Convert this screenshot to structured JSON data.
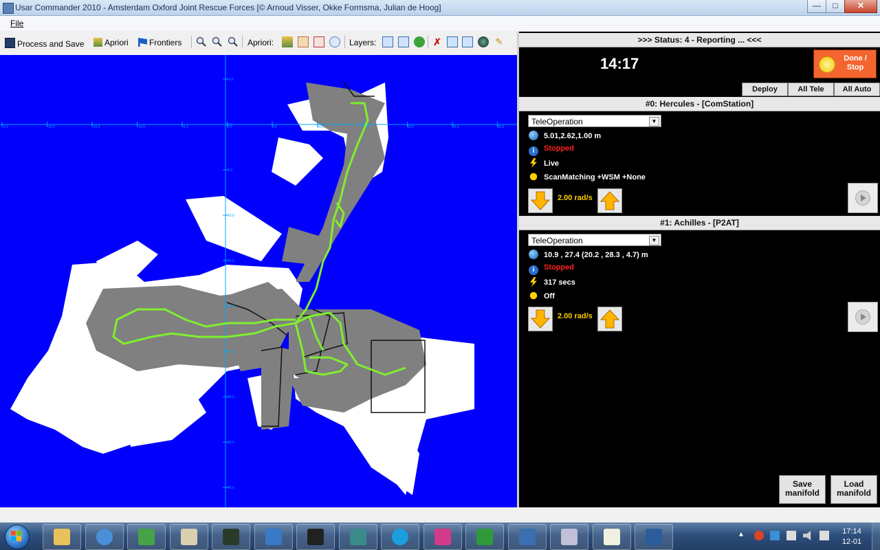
{
  "window": {
    "title": "Usar Commander 2010 - Amsterdam Oxford Joint Rescue Forces [© Arnoud Visser, Okke Formsma, Julian de Hoog]",
    "minimize": "—",
    "maximize": "□",
    "close": "✕"
  },
  "menu": {
    "file": "File"
  },
  "toolbar": {
    "process_save": "Process and Save",
    "apriori_btn": "Apriori",
    "frontiers": "Frontiers",
    "apriori_label": "Apriori:",
    "layers_label": "Layers:"
  },
  "map": {
    "x_ticks": [
      "-3.0",
      "-20.0",
      "-15.0",
      "-10.0",
      "-5.0",
      "0.0",
      "5.0",
      "10.0",
      "15.0",
      "20.0",
      "25.0",
      "30.0"
    ],
    "y_ticks": [
      "-5.0",
      "0.0",
      "5.0",
      "10.0",
      "15.0",
      "20.0",
      "25.0",
      "30.0",
      "35.0",
      "40.0"
    ]
  },
  "status": {
    "header": ">>> Status: 4 - Reporting ... <<<",
    "time": "14:17",
    "done_label": "Done /\nStop",
    "deploy": "Deploy",
    "all_tele": "All Tele",
    "all_auto": "All Auto"
  },
  "robots": [
    {
      "header": "#0: Hercules - [ComStation]",
      "mode": "TeleOperation",
      "position": "5.01,2.62,1.00 m",
      "state": "Stopped",
      "link": "Live",
      "slam": "ScanMatching +WSM +None",
      "speed": "2.00 rad/s"
    },
    {
      "header": "#1: Achilles - [P2AT]",
      "mode": "TeleOperation",
      "position": "10.9 , 27.4 (20.2 , 28.3 , 4.7) m",
      "state": "Stopped",
      "link": "317 secs",
      "slam": "Off",
      "speed": "2.00 rad/s"
    }
  ],
  "manifold": {
    "save": "Save\nmanifold",
    "load": "Load\nmanifold"
  },
  "taskbar": {
    "clock_time": "17:14",
    "clock_date": "12-01",
    "apps": [
      "explorer",
      "chrome",
      "messenger",
      "notepad",
      "perfmon",
      "itunes",
      "console",
      "network",
      "skype",
      "visual-studio",
      "cygwin",
      "virtualbox",
      "usar-commander",
      "editor",
      "python"
    ]
  },
  "colors": {
    "map_bg": "#0000fc",
    "map_free": "#ffffff",
    "map_explored": "#808080",
    "path": "#7fef2e",
    "axis": "#00aaff",
    "done_btn": "#f4652f"
  }
}
